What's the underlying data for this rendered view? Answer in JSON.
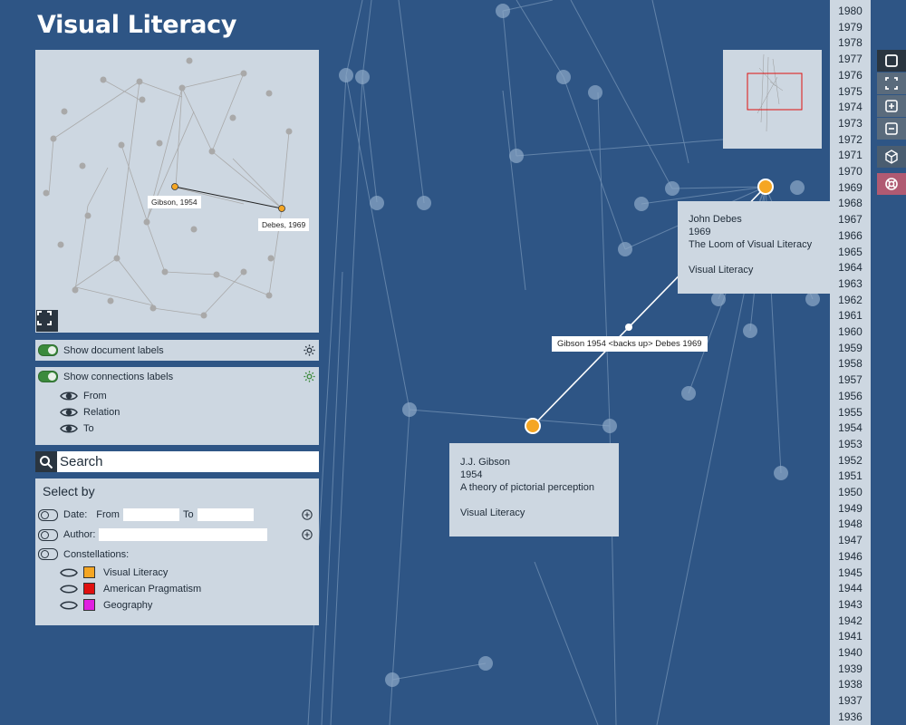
{
  "title": "Visual Literacy",
  "minimap": {
    "label_a": "Gibson, 1954",
    "label_b": "Debes, 1969"
  },
  "toggles": {
    "doc_labels": "Show document labels",
    "conn_labels": "Show connections labels",
    "conn_items": [
      "From",
      "Relation",
      "To"
    ]
  },
  "search": {
    "placeholder": "Search"
  },
  "select_by": {
    "heading": "Select by",
    "date_label": "Date:",
    "from_label": "From",
    "to_label": "To",
    "author_label": "Author:",
    "constellations_label": "Constellations:",
    "constellations": [
      {
        "name": "Visual Literacy",
        "color": "#f5a623"
      },
      {
        "name": "American Pragmatism",
        "color": "#e01010"
      },
      {
        "name": "Geography",
        "color": "#e020e0"
      }
    ]
  },
  "cards": {
    "debes": {
      "author": "John Debes",
      "year": "1969",
      "title": "The Loom of Visual Literacy",
      "constellation": "Visual Literacy"
    },
    "gibson": {
      "author": "J.J. Gibson",
      "year": "1954",
      "title": "A theory of pictorial perception",
      "constellation": "Visual Literacy"
    }
  },
  "connection_label": "Gibson 1954 <backs up> Debes 1969",
  "timeline_years": [
    "1980",
    "1979",
    "1978",
    "1977",
    "1976",
    "1975",
    "1974",
    "1973",
    "1972",
    "1971",
    "1970",
    "1969",
    "1968",
    "1967",
    "1966",
    "1965",
    "1964",
    "1963",
    "1962",
    "1961",
    "1960",
    "1959",
    "1958",
    "1957",
    "1956",
    "1955",
    "1954",
    "1953",
    "1952",
    "1951",
    "1950",
    "1949",
    "1948",
    "1947",
    "1946",
    "1945",
    "1944",
    "1943",
    "1942",
    "1941",
    "1940",
    "1939",
    "1938",
    "1937",
    "1936"
  ],
  "colors": {
    "background": "#2e5585",
    "panel": "#cdd7e1",
    "highlight": "#f5a623"
  },
  "icons": [
    "expand-icon",
    "gear-icon",
    "eye-icon",
    "search-icon",
    "plus-circle-icon",
    "square-icon",
    "fullscreen-icon",
    "zoom-in-icon",
    "zoom-out-icon",
    "cube-icon",
    "lifebuoy-icon"
  ]
}
